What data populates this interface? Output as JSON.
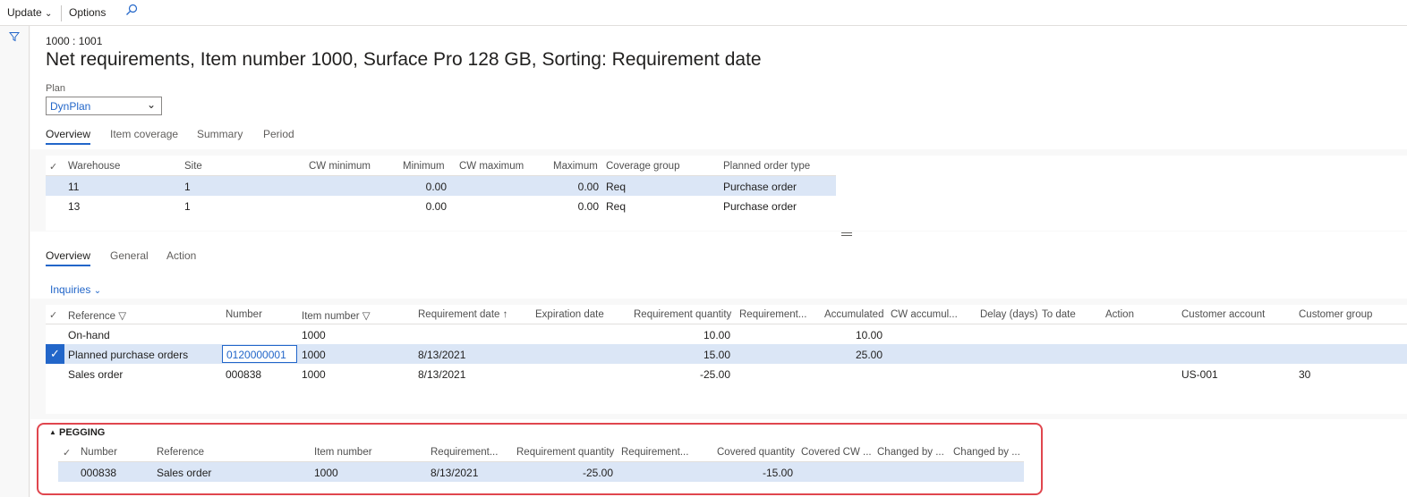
{
  "toolbar": {
    "update": "Update",
    "options": "Options"
  },
  "page": {
    "breadcrumb": "1000 : 1001",
    "title": "Net requirements, Item number 1000, Surface Pro 128 GB, Sorting: Requirement date"
  },
  "plan": {
    "label": "Plan",
    "value": "DynPlan"
  },
  "top_tabs": [
    "Overview",
    "Item coverage",
    "Summary",
    "Period"
  ],
  "coverage_grid": {
    "headers": [
      "Warehouse",
      "Site",
      "CW minimum",
      "Minimum",
      "CW maximum",
      "Maximum",
      "Coverage group",
      "Planned order type"
    ],
    "rows": [
      {
        "warehouse": "11",
        "site": "1",
        "cw_min": "",
        "minimum": "0.00",
        "cw_max": "",
        "maximum": "0.00",
        "coverage_group": "Req",
        "planned_order_type": "Purchase order"
      },
      {
        "warehouse": "13",
        "site": "1",
        "cw_min": "",
        "minimum": "0.00",
        "cw_max": "",
        "maximum": "0.00",
        "coverage_group": "Req",
        "planned_order_type": "Purchase order"
      }
    ]
  },
  "lower_tabs": [
    "Overview",
    "General",
    "Action"
  ],
  "inquiries": "Inquiries",
  "req_grid": {
    "headers": [
      "Reference",
      "Number",
      "Item number",
      "Requirement date",
      "Expiration date",
      "Requirement quantity",
      "Requirement...",
      "Accumulated",
      "CW accumul...",
      "Delay (days)",
      "To date",
      "Action",
      "Customer account",
      "Customer group"
    ],
    "rows": [
      {
        "reference": "On-hand",
        "number": "",
        "item": "1000",
        "date": "",
        "qty": "10.00",
        "accum": "10.00",
        "cust_acc": "",
        "cust_grp": ""
      },
      {
        "reference": "Planned purchase orders",
        "number": "0120000001",
        "item": "1000",
        "date": "8/13/2021",
        "qty": "15.00",
        "accum": "25.00",
        "cust_acc": "",
        "cust_grp": ""
      },
      {
        "reference": "Sales order",
        "number": "000838",
        "item": "1000",
        "date": "8/13/2021",
        "qty": "-25.00",
        "accum": "",
        "cust_acc": "US-001",
        "cust_grp": "30"
      }
    ]
  },
  "pegging": {
    "title": "PEGGING",
    "headers": [
      "Number",
      "Reference",
      "Item number",
      "Requirement...",
      "Requirement quantity",
      "Requirement...",
      "Covered quantity",
      "Covered CW ...",
      "Changed by ...",
      "Changed by ..."
    ],
    "rows": [
      {
        "number": "000838",
        "reference": "Sales order",
        "item": "1000",
        "date": "8/13/2021",
        "qty": "-25.00",
        "covered": "-15.00"
      }
    ]
  }
}
